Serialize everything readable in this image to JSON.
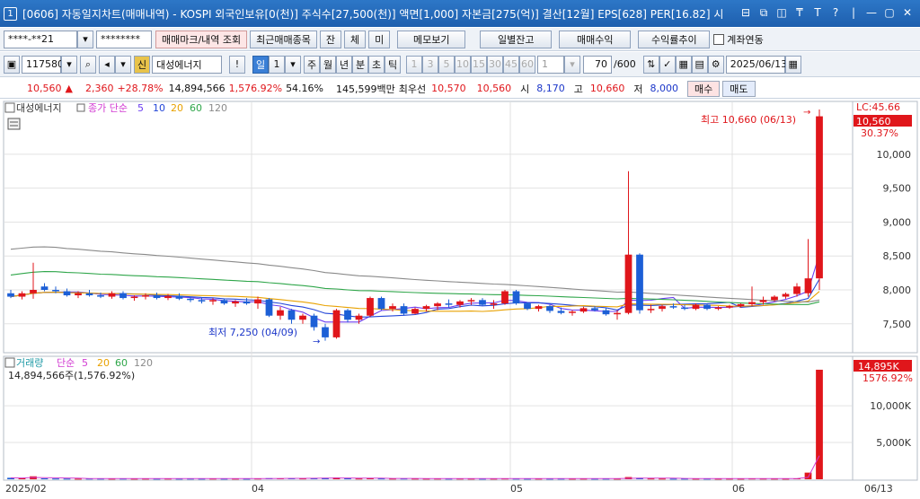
{
  "window": {
    "number": "1",
    "title": "[0606] 자동일지차트(매매내역) - KOSPI 외국인보유[0(천)] 주식수[27,500(천)] 액면[1,000] 자본금[275(억)] 결산[12월] EPS[628] PER[16.82] 시",
    "controls": [
      "⊟",
      "⧉",
      "◫",
      "₸",
      "T",
      "?",
      "|",
      "—",
      "▢",
      "✕"
    ]
  },
  "toolbar1": {
    "account": "****-**21",
    "password": "********",
    "buttons": [
      "매매마크/내역 조회",
      "최근매매종목",
      "잔",
      "체",
      "미",
      "메모보기",
      "일별잔고",
      "매매수익",
      "수익률추이"
    ],
    "checkbox_label": "계좌연동"
  },
  "toolbar2": {
    "code": "117580",
    "badge": "신",
    "name": "대성에너지",
    "exclaim": "!",
    "period_selected": "일",
    "period_num": "1",
    "periods": [
      "주",
      "월",
      "년",
      "분",
      "초",
      "틱"
    ],
    "minutes": [
      "1",
      "3",
      "5",
      "10",
      "15",
      "30",
      "45",
      "60"
    ],
    "minute_sel": "1",
    "count": "70",
    "count_total": "/600",
    "date": "2025/06/13"
  },
  "quote": {
    "price": "10,560",
    "arrow": "▲",
    "change": "2,360",
    "rate": "+28.78%",
    "volume": "14,894,566",
    "volume_pct": "1,576.92%",
    "ratio": "54.16%",
    "amount": "145,599백만",
    "best_label": "최우선",
    "ask": "10,570",
    "bid": "10,560",
    "open_label": "시",
    "open": "8,170",
    "high_label": "고",
    "high": "10,660",
    "low_label": "저",
    "low": "8,000",
    "buy": "매수",
    "sell": "매도"
  },
  "price_panel": {
    "name": "대성에너지",
    "ma_label": "종가 단순",
    "ma": [
      {
        "p": "5",
        "color": "#6b3df0"
      },
      {
        "p": "10",
        "color": "#2346d8"
      },
      {
        "p": "20",
        "color": "#e8a100"
      },
      {
        "p": "60",
        "color": "#2fa64a"
      },
      {
        "p": "120",
        "color": "#8a8a8a"
      }
    ],
    "y_ticks": [
      "10,000",
      "9,500",
      "9,000",
      "8,500",
      "8,000",
      "7,500"
    ],
    "lc": "LC:45.66",
    "current": "10,560",
    "current_pct": "30.37%",
    "high_note": "최고 10,660 (06/13)",
    "low_note": "최저 7,250 (04/09)"
  },
  "volume_panel": {
    "name": "거래량",
    "ma_label": "단순",
    "ma": [
      {
        "p": "5",
        "color": "#d23cd2"
      },
      {
        "p": "20",
        "color": "#e8a100"
      },
      {
        "p": "60",
        "color": "#2fa64a"
      },
      {
        "p": "120",
        "color": "#8a8a8a"
      }
    ],
    "info": "14,894,566주(1,576.92%)",
    "y_ticks": [
      "10,000K",
      "5,000K"
    ],
    "current": "14,895K",
    "current_pct": "1576.92%"
  },
  "x_axis": [
    "2025/02",
    "04",
    "05",
    "06",
    "06/13"
  ],
  "chart_data": {
    "type": "candlestick",
    "ylim": [
      7100,
      10700
    ],
    "candles": [
      {
        "o": 7950,
        "h": 8000,
        "l": 7880,
        "c": 7900
      },
      {
        "o": 7900,
        "h": 7980,
        "l": 7860,
        "c": 7950
      },
      {
        "o": 7950,
        "h": 8400,
        "l": 7870,
        "c": 8000
      },
      {
        "o": 8050,
        "h": 8100,
        "l": 7980,
        "c": 8000
      },
      {
        "o": 8000,
        "h": 8050,
        "l": 7950,
        "c": 7980
      },
      {
        "o": 7980,
        "h": 8020,
        "l": 7900,
        "c": 7920
      },
      {
        "o": 7920,
        "h": 7980,
        "l": 7880,
        "c": 7950
      },
      {
        "o": 7950,
        "h": 8000,
        "l": 7900,
        "c": 7920
      },
      {
        "o": 7920,
        "h": 7960,
        "l": 7880,
        "c": 7900
      },
      {
        "o": 7900,
        "h": 7980,
        "l": 7870,
        "c": 7950
      },
      {
        "o": 7950,
        "h": 7980,
        "l": 7860,
        "c": 7880
      },
      {
        "o": 7880,
        "h": 7920,
        "l": 7840,
        "c": 7900
      },
      {
        "o": 7900,
        "h": 7950,
        "l": 7860,
        "c": 7920
      },
      {
        "o": 7920,
        "h": 7960,
        "l": 7860,
        "c": 7880
      },
      {
        "o": 7880,
        "h": 7940,
        "l": 7850,
        "c": 7910
      },
      {
        "o": 7910,
        "h": 7950,
        "l": 7850,
        "c": 7870
      },
      {
        "o": 7870,
        "h": 7900,
        "l": 7820,
        "c": 7850
      },
      {
        "o": 7850,
        "h": 7890,
        "l": 7800,
        "c": 7830
      },
      {
        "o": 7830,
        "h": 7880,
        "l": 7780,
        "c": 7850
      },
      {
        "o": 7850,
        "h": 7870,
        "l": 7780,
        "c": 7800
      },
      {
        "o": 7800,
        "h": 7850,
        "l": 7750,
        "c": 7830
      },
      {
        "o": 7830,
        "h": 7880,
        "l": 7780,
        "c": 7800
      },
      {
        "o": 7800,
        "h": 7900,
        "l": 7720,
        "c": 7860
      },
      {
        "o": 7860,
        "h": 7880,
        "l": 7600,
        "c": 7620
      },
      {
        "o": 7620,
        "h": 7750,
        "l": 7560,
        "c": 7700
      },
      {
        "o": 7700,
        "h": 7720,
        "l": 7500,
        "c": 7560
      },
      {
        "o": 7560,
        "h": 7650,
        "l": 7500,
        "c": 7620
      },
      {
        "o": 7620,
        "h": 7650,
        "l": 7400,
        "c": 7450
      },
      {
        "o": 7450,
        "h": 7500,
        "l": 7250,
        "c": 7300
      },
      {
        "o": 7300,
        "h": 7720,
        "l": 7280,
        "c": 7700
      },
      {
        "o": 7700,
        "h": 7720,
        "l": 7520,
        "c": 7560
      },
      {
        "o": 7560,
        "h": 7650,
        "l": 7500,
        "c": 7620
      },
      {
        "o": 7620,
        "h": 7900,
        "l": 7600,
        "c": 7880
      },
      {
        "o": 7880,
        "h": 7900,
        "l": 7700,
        "c": 7720
      },
      {
        "o": 7720,
        "h": 7800,
        "l": 7680,
        "c": 7760
      },
      {
        "o": 7760,
        "h": 7800,
        "l": 7620,
        "c": 7650
      },
      {
        "o": 7650,
        "h": 7740,
        "l": 7640,
        "c": 7720
      },
      {
        "o": 7720,
        "h": 7780,
        "l": 7680,
        "c": 7760
      },
      {
        "o": 7760,
        "h": 7820,
        "l": 7700,
        "c": 7800
      },
      {
        "o": 7800,
        "h": 7860,
        "l": 7740,
        "c": 7780
      },
      {
        "o": 7780,
        "h": 7850,
        "l": 7740,
        "c": 7830
      },
      {
        "o": 7830,
        "h": 7880,
        "l": 7780,
        "c": 7850
      },
      {
        "o": 7850,
        "h": 7880,
        "l": 7760,
        "c": 7780
      },
      {
        "o": 7780,
        "h": 7850,
        "l": 7720,
        "c": 7800
      },
      {
        "o": 7800,
        "h": 8000,
        "l": 7780,
        "c": 7980
      },
      {
        "o": 7980,
        "h": 8000,
        "l": 7780,
        "c": 7800
      },
      {
        "o": 7800,
        "h": 7820,
        "l": 7700,
        "c": 7720
      },
      {
        "o": 7720,
        "h": 7780,
        "l": 7680,
        "c": 7760
      },
      {
        "o": 7760,
        "h": 7780,
        "l": 7660,
        "c": 7690
      },
      {
        "o": 7690,
        "h": 7740,
        "l": 7640,
        "c": 7660
      },
      {
        "o": 7660,
        "h": 7700,
        "l": 7620,
        "c": 7680
      },
      {
        "o": 7680,
        "h": 7750,
        "l": 7660,
        "c": 7730
      },
      {
        "o": 7730,
        "h": 7760,
        "l": 7680,
        "c": 7700
      },
      {
        "o": 7700,
        "h": 7740,
        "l": 7620,
        "c": 7640
      },
      {
        "o": 7640,
        "h": 7700,
        "l": 7560,
        "c": 7660
      },
      {
        "o": 7660,
        "h": 9750,
        "l": 7640,
        "c": 8520
      },
      {
        "o": 8520,
        "h": 8540,
        "l": 7650,
        "c": 7700
      },
      {
        "o": 7700,
        "h": 7780,
        "l": 7660,
        "c": 7720
      },
      {
        "o": 7720,
        "h": 7780,
        "l": 7680,
        "c": 7760
      },
      {
        "o": 7760,
        "h": 7800,
        "l": 7720,
        "c": 7740
      },
      {
        "o": 7740,
        "h": 7780,
        "l": 7700,
        "c": 7720
      },
      {
        "o": 7720,
        "h": 7800,
        "l": 7700,
        "c": 7780
      },
      {
        "o": 7780,
        "h": 7800,
        "l": 7700,
        "c": 7720
      },
      {
        "o": 7720,
        "h": 7760,
        "l": 7700,
        "c": 7740
      },
      {
        "o": 7740,
        "h": 7780,
        "l": 7720,
        "c": 7760
      },
      {
        "o": 7760,
        "h": 7800,
        "l": 7740,
        "c": 7790
      },
      {
        "o": 7790,
        "h": 8050,
        "l": 7760,
        "c": 7820
      },
      {
        "o": 7820,
        "h": 7900,
        "l": 7780,
        "c": 7850
      },
      {
        "o": 7850,
        "h": 7920,
        "l": 7830,
        "c": 7900
      },
      {
        "o": 7900,
        "h": 7960,
        "l": 7870,
        "c": 7940
      },
      {
        "o": 7940,
        "h": 8100,
        "l": 7900,
        "c": 8050
      },
      {
        "o": 7950,
        "h": 8750,
        "l": 7900,
        "c": 8170
      },
      {
        "o": 8170,
        "h": 10660,
        "l": 8000,
        "c": 10560
      }
    ],
    "volume_ylim": [
      0,
      15500000
    ],
    "volumes": [
      200000,
      150000,
      400000,
      120000,
      100000,
      90000,
      80000,
      90000,
      85000,
      80000,
      90000,
      80000,
      85000,
      80000,
      90000,
      80000,
      85000,
      80000,
      90000,
      80000,
      85000,
      80000,
      100000,
      150000,
      120000,
      130000,
      110000,
      150000,
      200000,
      250000,
      120000,
      100000,
      150000,
      110000,
      90000,
      100000,
      90000,
      85000,
      90000,
      85000,
      90000,
      85000,
      80000,
      85000,
      100000,
      90000,
      80000,
      85000,
      80000,
      85000,
      80000,
      85000,
      80000,
      85000,
      80000,
      300000,
      200000,
      100000,
      90000,
      80000,
      85000,
      80000,
      85000,
      80000,
      85000,
      80000,
      100000,
      90000,
      85000,
      80000,
      120000,
      900000,
      14894566
    ]
  }
}
